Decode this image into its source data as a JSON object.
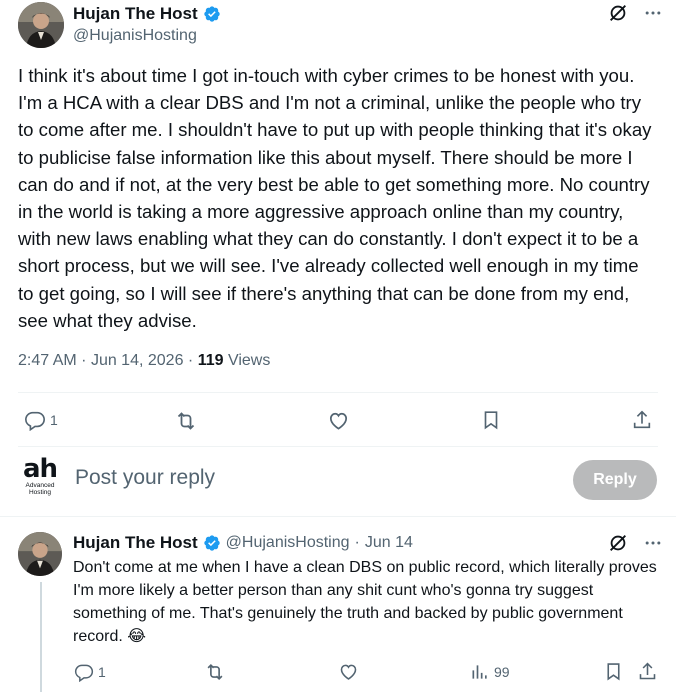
{
  "main_tweet": {
    "display_name": "Hujan The Host",
    "handle": "@HujanisHosting",
    "text": "I think it's about time I got in-touch with cyber crimes to be honest with you. I'm a HCA with a clear DBS and I'm not a criminal, unlike the people who try to come after me. I shouldn't have to put up with people thinking that it's okay to publicise false information like this about myself. There should be more I can do and if not, at the very best be able to get something more. No country in the world is taking a more aggressive approach online than my country, with new laws enabling what they can do constantly. I don't expect it to be a short process, but we will see. I've already collected well enough in my time to get going, so I will see if there's anything that can be done from my end, see what they advise.",
    "time": "2:47 AM",
    "date": "Jun 14, 2026",
    "views_count": "119",
    "views_label": "Views",
    "reply_count": "1"
  },
  "composer": {
    "logo_text": "ah",
    "logo_sub_1": "Advanced",
    "logo_sub_2": "Hosting",
    "placeholder": "Post your reply",
    "button_label": "Reply"
  },
  "reply_tweet": {
    "display_name": "Hujan The Host",
    "handle": "@HujanisHosting",
    "date": "Jun 14",
    "text": "Don't come at me when I have a clean DBS on public record, which literally proves I'm more likely a better person than any shit cunt who's gonna try suggest something of me. That's genuinely the truth and backed by public government record. 😂",
    "reply_count": "1",
    "views_count": "99"
  },
  "colors": {
    "verified": "#1d9bf0",
    "text": "#0f1419",
    "secondary": "#536471",
    "reply_button_disabled": "#b9babb"
  },
  "icons": [
    "grok-icon",
    "more-icon",
    "reply-icon",
    "retweet-icon",
    "like-icon",
    "bookmark-icon",
    "share-icon",
    "views-icon",
    "verified-icon"
  ]
}
